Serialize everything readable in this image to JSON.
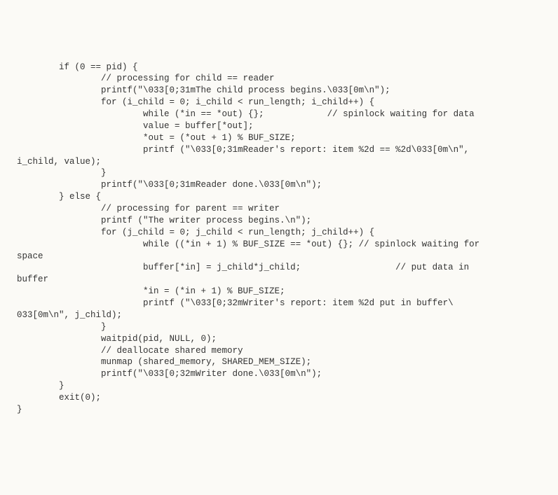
{
  "code": {
    "lines": [
      "        if (0 == pid) {",
      "                // processing for child == reader",
      "                printf(\"\\033[0;31mThe child process begins.\\033[0m\\n\");",
      "",
      "                for (i_child = 0; i_child < run_length; i_child++) {",
      "                        while (*in == *out) {};            // spinlock waiting for data",
      "",
      "                        value = buffer[*out];",
      "                        *out = (*out + 1) % BUF_SIZE;",
      "",
      "                        printf (\"\\033[0;31mReader's report: item %2d == %2d\\033[0m\\n\",",
      "i_child, value);",
      "                }",
      "                printf(\"\\033[0;31mReader done.\\033[0m\\n\");",
      "",
      "        } else {",
      "                // processing for parent == writer",
      "                printf (\"The writer process begins.\\n\");",
      "",
      "                for (j_child = 0; j_child < run_length; j_child++) {",
      "                        while ((*in + 1) % BUF_SIZE == *out) {}; // spinlock waiting for",
      "space",
      "",
      "                        buffer[*in] = j_child*j_child;                  // put data in",
      "buffer",
      "                        *in = (*in + 1) % BUF_SIZE;",
      "",
      "                        printf (\"\\033[0;32mWriter's report: item %2d put in buffer\\",
      "033[0m\\n\", j_child);",
      "                }",
      "                waitpid(pid, NULL, 0);",
      "",
      "                // deallocate shared memory",
      "                munmap (shared_memory, SHARED_MEM_SIZE);",
      "",
      "                printf(\"\\033[0;32mWriter done.\\033[0m\\n\");",
      "        }",
      "",
      "        exit(0);",
      "}"
    ]
  }
}
